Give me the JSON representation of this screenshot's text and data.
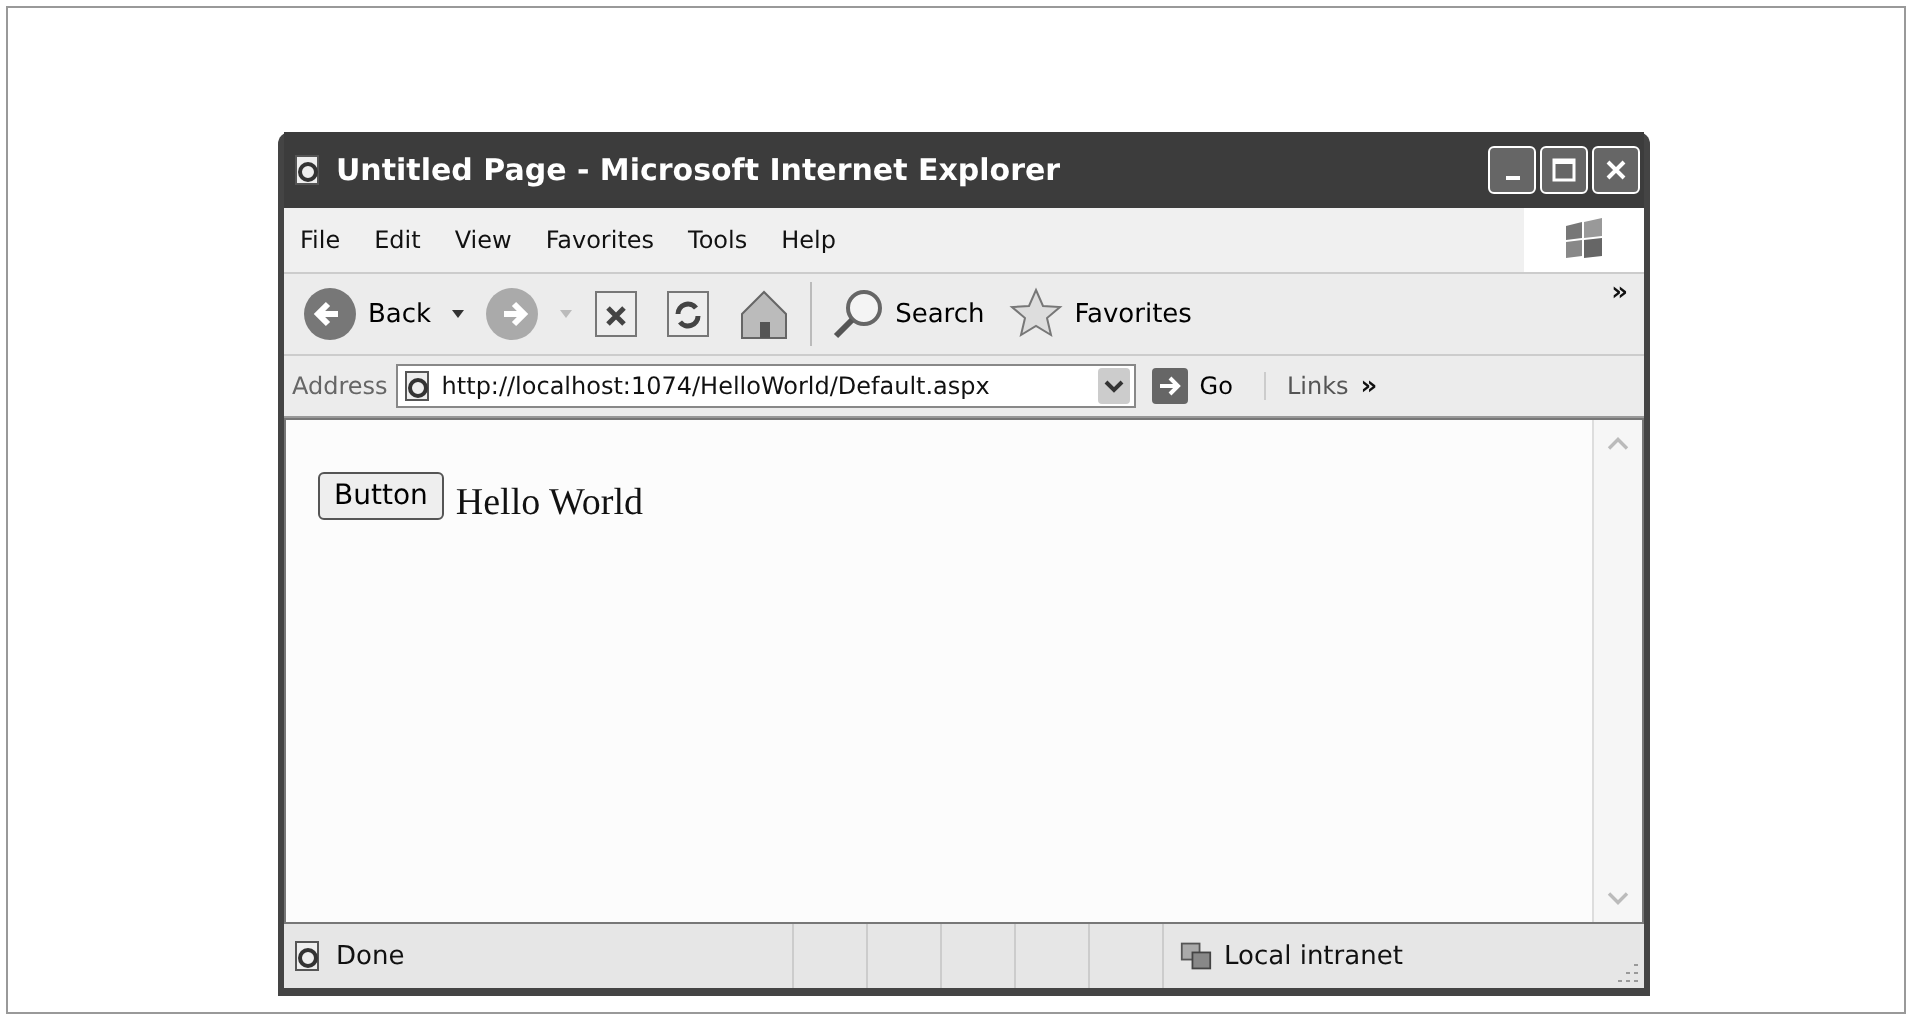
{
  "window": {
    "title": "Untitled Page - Microsoft Internet Explorer"
  },
  "menu": [
    "File",
    "Edit",
    "View",
    "Favorites",
    "Tools",
    "Help"
  ],
  "toolbar": {
    "back": "Back",
    "search": "Search",
    "favorites": "Favorites",
    "overflow": "»"
  },
  "address_bar": {
    "label": "Address",
    "value": "http://localhost:1074/HelloWorld/Default.aspx",
    "go": "Go",
    "links": "Links",
    "overflow": "»"
  },
  "page": {
    "button": "Button",
    "text": "Hello World"
  },
  "status_bar": {
    "status": "Done",
    "zone": "Local intranet"
  }
}
